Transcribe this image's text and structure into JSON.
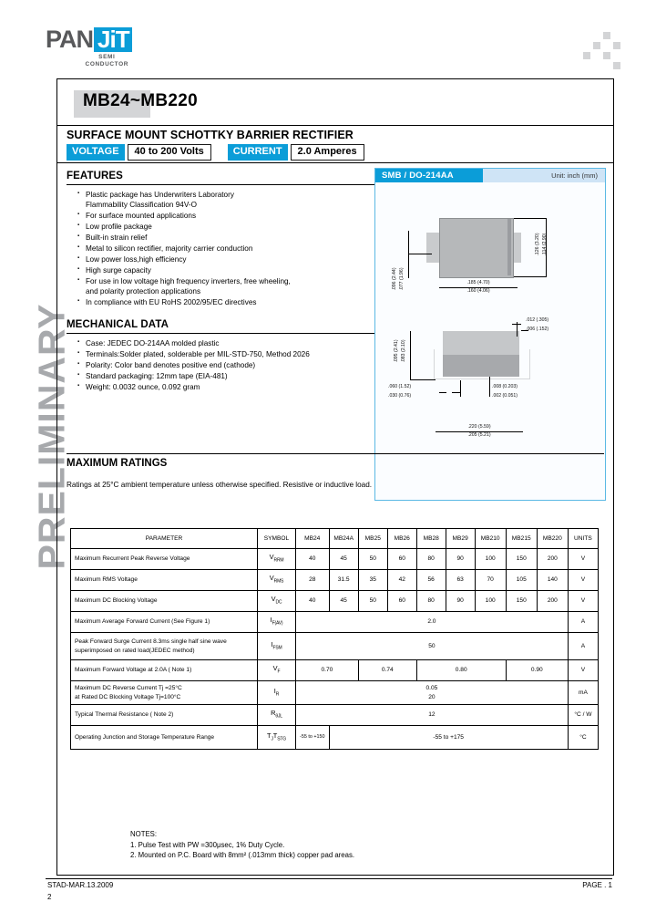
{
  "watermark": "PRELIMINARY",
  "logo": {
    "name_part1": "PAN",
    "name_part2": "JiT",
    "sub_line1": "SEMI",
    "sub_line2": "CONDUCTOR",
    "brand_color": "#0b9dd8",
    "text_color": "#58595b"
  },
  "header": {
    "part_number": "MB24~MB220",
    "subtitle": "SURFACE  MOUNT SCHOTTKY BARRIER RECTIFIER",
    "voltage_label": "VOLTAGE",
    "voltage_value": "40 to 200 Volts",
    "current_label": "CURRENT",
    "current_value": "2.0 Amperes"
  },
  "features": {
    "heading": "FEATURES",
    "items": [
      "Plastic package has Underwriters Laboratory",
      "Flammability Classification 94V-O",
      "For surface mounted applications",
      "Low profile package",
      "Built-in strain relief",
      "Metal to silicon rectifier, majority carrier conduction",
      "Low power loss,high efficiency",
      "High surge capacity",
      "For use in low voltage high frequency inverters, free wheeling,",
      "and polarity protection applications",
      "In compliance with EU RoHS 2002/95/EC directives"
    ]
  },
  "mechanical": {
    "heading": "MECHANICAL DATA",
    "items": [
      "Case: JEDEC DO-214AA molded plastic",
      "Terminals:Solder plated, solderable per MIL-STD-750, Method 2026",
      "Polarity: Color band denotes positive end (cathode)",
      "Standard packaging: 12mm tape (EIA-481)",
      "Weight: 0.0032 ounce, 0.092 gram"
    ]
  },
  "package": {
    "title": "SMB / DO-214AA",
    "unit_note": "Unit: inch (mm)",
    "top_view": {
      "width_dim": ".185 (4.70)",
      "width_dim2": ".160 (4.06)",
      "height_dim": ".126 (3.20)",
      "height_dim2": ".114 (2.90)",
      "lead_dim": ".096 (2.44)",
      "lead_dim2": ".077 (1.96)"
    },
    "side_view": {
      "thick_dim": ".012 (.305)",
      "thick_dim2": ".006 (.152)",
      "height_dim": ".095 (2.41)",
      "height_dim2": ".083 (2.10)",
      "lead_dim": ".060 (1.52)",
      "lead_dim2": ".030 (0.76)",
      "foot_dim": ".008 (0.203)",
      "foot_dim2": ".002 (0.051)",
      "len_dim": ".220 (5.59)",
      "len_dim2": ".205 (5.21)"
    }
  },
  "ratings": {
    "heading": "MAXIMUM RATINGS",
    "note": "Ratings at 25°C ambient temperature unless otherwise specified. Resistive or inductive load.",
    "columns": [
      "PARAMETER",
      "SYMBOL",
      "MB24",
      "MB24A",
      "MB25",
      "MB26",
      "MB28",
      "MB29",
      "MB210",
      "MB215",
      "MB220",
      "UNITS"
    ],
    "rows": [
      {
        "parameter": "Maximum Recurrent Peak Reverse Voltage",
        "symbol_main": "V",
        "symbol_sub": "RRM",
        "values": [
          "40",
          "45",
          "50",
          "60",
          "80",
          "90",
          "100",
          "150",
          "200"
        ],
        "units": "V"
      },
      {
        "parameter": "Maximum RMS Voltage",
        "symbol_main": "V",
        "symbol_sub": "RMS",
        "values": [
          "28",
          "31.5",
          "35",
          "42",
          "56",
          "63",
          "70",
          "105",
          "140"
        ],
        "units": "V"
      },
      {
        "parameter": "Maximum DC Blocking Voltage",
        "symbol_main": "V",
        "symbol_sub": "DC",
        "values": [
          "40",
          "45",
          "50",
          "60",
          "80",
          "90",
          "100",
          "150",
          "200"
        ],
        "units": "V"
      },
      {
        "parameter": "Maximum Average Forward  Current  (See  Figure  1)",
        "symbol_main": "I",
        "symbol_sub": "F(AV)",
        "merged_value": "2.0",
        "units": "A"
      },
      {
        "parameter": "Peak  Forward Surge Current 8.3ms single half sine wave superimposed on rated load(JEDEC method)",
        "symbol_main": "I",
        "symbol_sub": "FSM",
        "merged_value": "50",
        "units": "A"
      },
      {
        "parameter": "Maximum Forward Voltage at 2.0A  ( Note 1)",
        "symbol_main": "V",
        "symbol_sub": "F",
        "group_values": [
          "0.70",
          "0.74",
          "0.80",
          "0.90"
        ],
        "units": "V"
      },
      {
        "parameter_line1": "Maximum DC Reverse Current Tj =25°C",
        "parameter_line2": "at Rated DC Blocking Voltage Tj=100°C",
        "symbol_main": "I",
        "symbol_sub": "R",
        "merged_value_line1": "0.05",
        "merged_value_line2": "20",
        "units": "mA"
      },
      {
        "parameter": "Typical Thermal Resistance ( Note 2)",
        "symbol_main": "R",
        "symbol_sub": "θJL",
        "merged_value": "12",
        "units": "°C / W"
      },
      {
        "parameter": "Operating Junction and Storage Temperature Range",
        "symbol_main": "T",
        "symbol_sub": "J",
        "symbol_main2": "T",
        "symbol_sub2": "STG",
        "first_value": "-55 to +150",
        "merged_value": "-55 to +175",
        "units": "°C"
      }
    ]
  },
  "notes": {
    "heading": "NOTES:",
    "items": [
      "1. Pulse Test with PW =300μsec, 1% Duty Cycle.",
      "2. Mounted on P.C. Board with 8mm²  (.013mm thick) copper pad areas."
    ]
  },
  "footer": {
    "left": "STAD-MAR.13.2009",
    "left2": "2",
    "right": "PAGE . 1"
  }
}
